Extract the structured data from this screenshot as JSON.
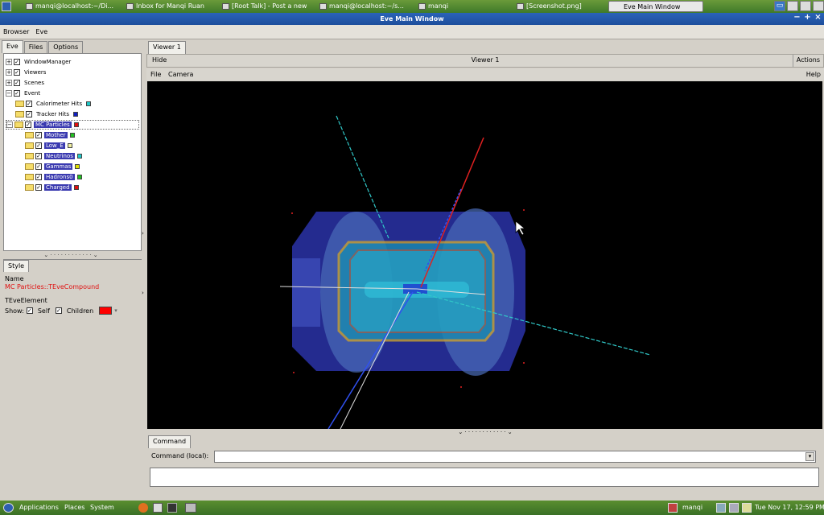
{
  "top_panel": {
    "tasks": [
      {
        "label": "manqi@localhost:~/Di..."
      },
      {
        "label": "Inbox for Manqi Ruan"
      },
      {
        "label": "[Root Talk] - Post a new"
      },
      {
        "label": "manqi@localhost:~/s..."
      },
      {
        "label": "manqi"
      },
      {
        "label": "[Screenshot.png]"
      },
      {
        "label": "Eve Main Window"
      }
    ]
  },
  "window": {
    "title": "Eve Main Window"
  },
  "menubar": {
    "browser": "Browser",
    "eve": "Eve"
  },
  "left_tabs": [
    "Eve",
    "Files",
    "Options"
  ],
  "tree": {
    "window_manager": "WindowManager",
    "viewers": "Viewers",
    "scenes": "Scenes",
    "event": "Event",
    "calorimeter_hits": "Calorimeter Hits",
    "tracker_hits": "Tracker Hits",
    "mc_particles": "MC Particles",
    "mother": "Mother",
    "low_e": "Low_E",
    "neutrinos": "Neutrinos",
    "gamma": "Gammas",
    "hadrons0": "Hadrons0",
    "charged": "Charged"
  },
  "colors": {
    "calorimeter_hits": "#20c8c8",
    "tracker_hits": "#1020c0",
    "mc_particles": "#e01010",
    "mother": "#20c020",
    "low_e": "#f0f0a0",
    "neutrinos": "#20c8c8",
    "gamma": "#e0e000",
    "hadrons0": "#20c020",
    "charged": "#e01010",
    "children_color": "#ff0000"
  },
  "style_panel": {
    "tab": "Style",
    "name_label": "Name",
    "name_value": "MC Particles::TEveCompound",
    "element_label": "TEveElement",
    "show_label": "Show:",
    "self_label": "Self",
    "children_label": "Children"
  },
  "viewer": {
    "tab": "Viewer 1",
    "hide": "Hide",
    "title": "Viewer 1",
    "actions": "Actions",
    "file": "File",
    "camera": "Camera",
    "help": "Help"
  },
  "command": {
    "tab": "Command",
    "label": "Command (local):"
  },
  "bottom_panel": {
    "applications": "Applications",
    "places": "Places",
    "system": "System",
    "user": "manqi",
    "clock": "Tue Nov 17, 12:59 PM"
  }
}
